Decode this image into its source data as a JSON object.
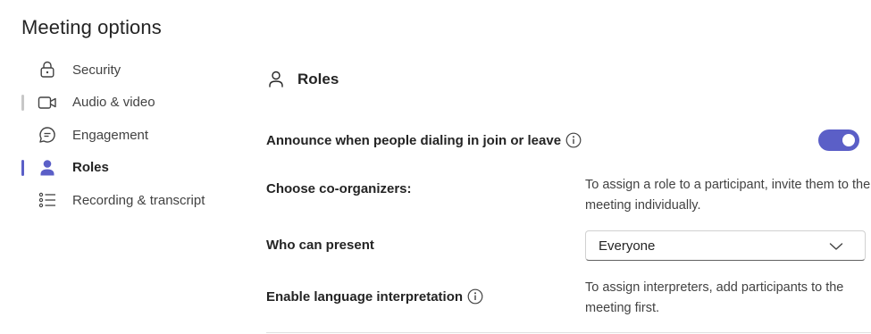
{
  "page": {
    "title": "Meeting options"
  },
  "sidebar": {
    "items": [
      {
        "label": "Security",
        "icon": "lock-icon"
      },
      {
        "label": "Audio & video",
        "icon": "video-camera-icon"
      },
      {
        "label": "Engagement",
        "icon": "chat-bubble-icon"
      },
      {
        "label": "Roles",
        "icon": "person-icon"
      },
      {
        "label": "Recording & transcript",
        "icon": "list-icon"
      }
    ],
    "active_item": "Roles"
  },
  "section": {
    "title": "Roles",
    "icon": "person-outline-icon"
  },
  "options": {
    "announce": {
      "label": "Announce when people dialing in join or leave",
      "enabled": true
    },
    "co_organizers": {
      "label": "Choose co-organizers:",
      "helper": "To assign a role to a participant, invite them to the meeting individually."
    },
    "who_can_present": {
      "label": "Who can present",
      "selected": "Everyone"
    },
    "interpretation": {
      "label": "Enable language interpretation",
      "helper": "To assign interpreters, add participants to the meeting first."
    }
  },
  "colors": {
    "accent": "#5b5fc7",
    "text": "#242424",
    "secondary_text": "#424242",
    "border": "#d1d1d1"
  }
}
